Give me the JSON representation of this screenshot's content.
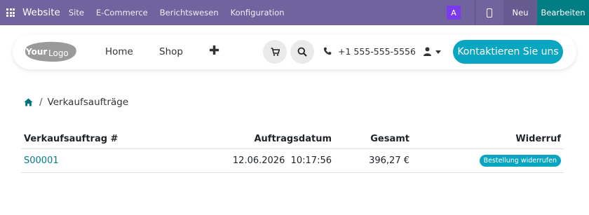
{
  "topbar": {
    "brand": "Website",
    "menu": [
      "Site",
      "E-Commerce",
      "Berichtswesen",
      "Konfiguration"
    ],
    "avatar_letter": "A",
    "new_label": "Neu",
    "edit_label": "Bearbeiten",
    "color": "#71639e",
    "edit_color": "#017e84"
  },
  "header": {
    "logo_text_bold": "Your",
    "logo_text": "Logo",
    "nav": [
      "Home",
      "Shop"
    ],
    "add_glyph": "✚",
    "phone": "+1 555-555-5556",
    "contact_label": "Kontaktieren Sie uns",
    "accent_color": "#0aa5c0"
  },
  "breadcrumb": {
    "separator": "/",
    "current": "Verkaufsaufträge"
  },
  "orders": {
    "columns": [
      "Verkaufsauftrag #",
      "Auftragsdatum",
      "Gesamt",
      "Widerruf"
    ],
    "rows": [
      {
        "number": "S00001",
        "date": "12.06.2026",
        "time": "10:17:56",
        "total": "396,27 €",
        "cancel_label": "Bestellung widerrufen"
      }
    ]
  }
}
